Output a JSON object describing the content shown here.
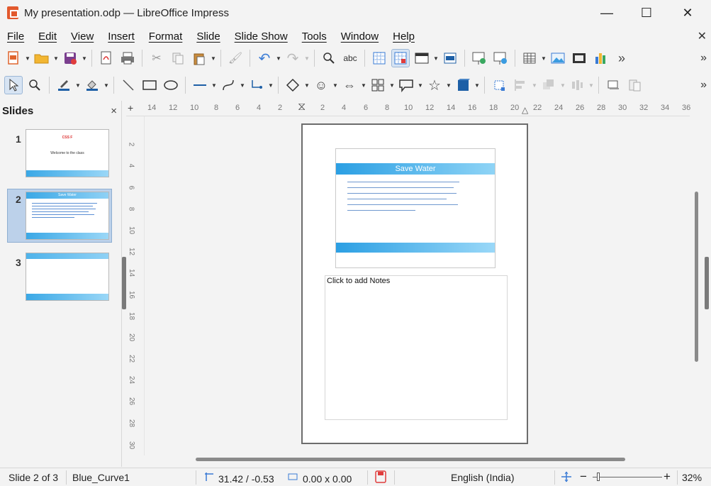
{
  "window": {
    "title": "My presentation.odp — LibreOffice Impress",
    "minimize_glyph": "—",
    "maximize_glyph": "☐",
    "close_glyph": "✕"
  },
  "menu": {
    "items": [
      "File",
      "Edit",
      "View",
      "Insert",
      "Format",
      "Slide",
      "Slide Show",
      "Tools",
      "Window",
      "Help"
    ],
    "close_document_glyph": "✕"
  },
  "toolbar_more_glyph": "»",
  "slides_pane": {
    "title": "Slides",
    "close_glyph": "×",
    "slides": [
      {
        "number": "1",
        "title": "CSS F",
        "subtitle": "Welcome to the class"
      },
      {
        "number": "2",
        "title": "Save Water"
      },
      {
        "number": "3"
      }
    ],
    "selected_index": 2
  },
  "ruler_horizontal": [
    "14",
    "12",
    "10",
    "8",
    "6",
    "4",
    "2",
    "2",
    "4",
    "6",
    "8",
    "10",
    "12",
    "14",
    "16",
    "18",
    "20",
    "22",
    "24",
    "26",
    "28",
    "30",
    "32",
    "34",
    "36"
  ],
  "ruler_vertical": [
    "2",
    "4",
    "6",
    "8",
    "10",
    "12",
    "14",
    "16",
    "18",
    "20",
    "22",
    "24",
    "26",
    "28",
    "30"
  ],
  "notes_page": {
    "slide_title": "Save Water",
    "notes_placeholder": "Click to add Notes"
  },
  "status": {
    "slide_position": "Slide 2 of 3",
    "master": "Blue_Curve1",
    "position": "31.42 / -0.53",
    "size": "0.00 x 0.00",
    "language": "English (India)",
    "zoom_minus": "−",
    "zoom_plus": "+",
    "zoom": "32%",
    "zoom_fraction": 0.32
  },
  "colors": {
    "accent_blue": "#2b9fe3",
    "selected_thumb": "#bcd1ea",
    "slide1_title_red": "#dd3333"
  }
}
